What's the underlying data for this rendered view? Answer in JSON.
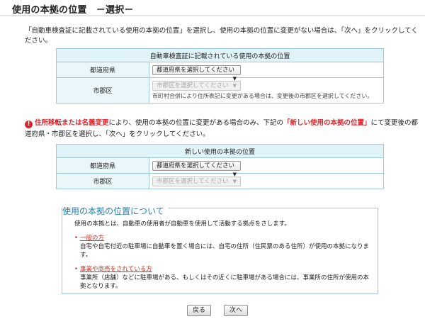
{
  "page": {
    "title": "使用の本拠の位置　－選択－",
    "intro": "「自動車検査証に記載されている使用の本拠の位置」を選択し、使用の本拠の位置に変更がない場合は、「次へ」をクリックしてください。"
  },
  "table1": {
    "header": "自動車検査証に記載されている使用の本拠の位置",
    "prefecture_label": "都道府県",
    "prefecture_select": "都道府県を選択してください",
    "city_label": "市郡区",
    "city_select": "市郡区を選択してください",
    "city_hint": "市町村合併により住所表記に変更がある場合は、変更後の市郡区を選択してください。"
  },
  "notice": {
    "icon": "!",
    "part1": "住所移転または名義変更",
    "part2": "により、使用の本拠の位置に変更がある場合のみ、下記の",
    "part3": "「新しい使用の本拠の位置」",
    "part4": "にて変更後の都道府県・市郡区を選択し、「次へ」をクリックしてください。"
  },
  "table2": {
    "header": "新しい使用の本拠の位置",
    "prefecture_label": "都道府県",
    "prefecture_select": "都道府県を選択してください",
    "city_label": "市郡区",
    "city_select": "市郡区を選択してください"
  },
  "info": {
    "title": "使用の本拠の位置について",
    "description": "使用の本拠とは、自動車の使用者が自動車を使用して活動する拠点をさします。",
    "items": [
      {
        "title": "一般の方",
        "text": "自宅や自宅付近の駐車場に自動車を置く場合には、自宅の住所（住民票のある住所）が使用の本拠になります。"
      },
      {
        "title": "事業や商売をされている方",
        "text": "事業所（店舗）などに駐車場がある、もしくはその近くに駐車場がある場合には、事業所の住所が使用の本拠となります。"
      }
    ]
  },
  "buttons": {
    "back": "戻る",
    "next": "次へ"
  },
  "colors": {
    "border": "#9ec9d6",
    "header_bg": "#dff3f9",
    "accent_red": "#d9262c",
    "info_title": "#2a7fa8"
  }
}
